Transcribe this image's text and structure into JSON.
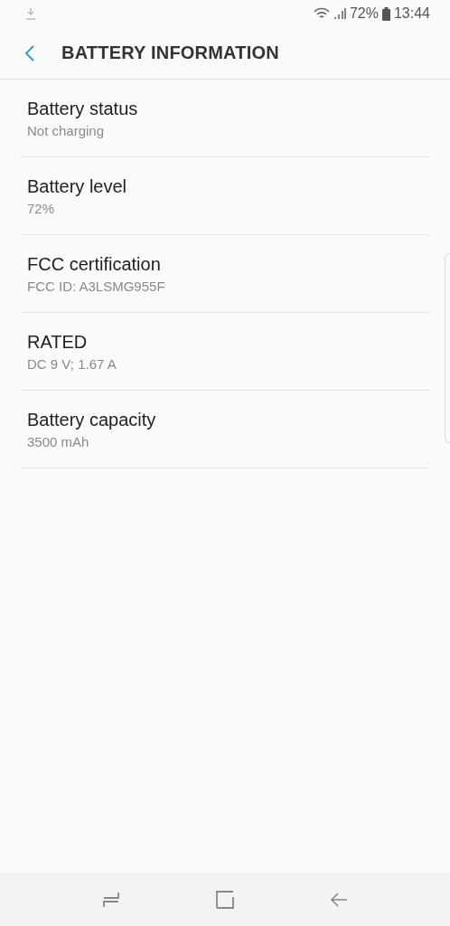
{
  "status_bar": {
    "battery": "72%",
    "time": "13:44"
  },
  "header": {
    "title": "BATTERY INFORMATION"
  },
  "items": [
    {
      "title": "Battery status",
      "value": "Not charging"
    },
    {
      "title": "Battery level",
      "value": "72%"
    },
    {
      "title": "FCC certification",
      "value": "FCC ID: A3LSMG955F"
    },
    {
      "title": "RATED",
      "value": "DC 9 V; 1.67 A"
    },
    {
      "title": "Battery capacity",
      "value": "3500 mAh"
    }
  ]
}
